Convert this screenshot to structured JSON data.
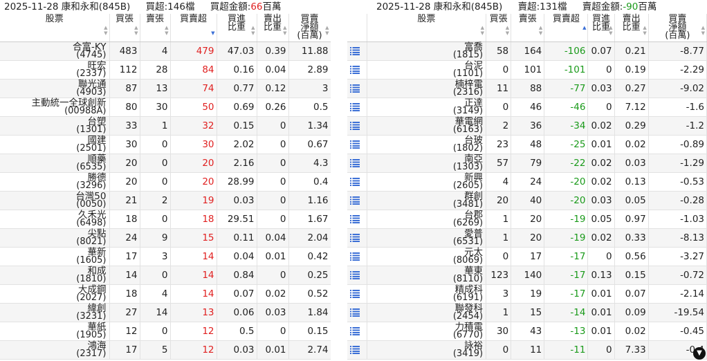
{
  "left": {
    "title": {
      "date": "2025-11-28",
      "broker": "康和永和(845B)",
      "summary": "買超:146檔",
      "amount_label": "買超金額:",
      "amount_value": "66",
      "amount_unit": "百萬"
    },
    "headers": [
      "股票",
      "買張",
      "賣張",
      "買賣超",
      "買進\n比重",
      "賣出\n比重",
      "買賣\n淨額\n(百萬)"
    ],
    "rows": [
      {
        "name": "合富-KY",
        "code": "(4745)",
        "buy": "483",
        "sell": "4",
        "net": "479",
        "buy_pct": "47.03",
        "sell_pct": "0.39",
        "amount": "11.88"
      },
      {
        "name": "旺宏",
        "code": "(2337)",
        "buy": "112",
        "sell": "28",
        "net": "84",
        "buy_pct": "0.16",
        "sell_pct": "0.04",
        "amount": "2.89"
      },
      {
        "name": "聯光通",
        "code": "(4903)",
        "buy": "87",
        "sell": "13",
        "net": "74",
        "buy_pct": "0.77",
        "sell_pct": "0.12",
        "amount": "3"
      },
      {
        "name": "主動統一全球創新",
        "code": "(00988A)",
        "buy": "80",
        "sell": "30",
        "net": "50",
        "buy_pct": "0.69",
        "sell_pct": "0.26",
        "amount": "0.5"
      },
      {
        "name": "台塑",
        "code": "(1301)",
        "buy": "33",
        "sell": "1",
        "net": "32",
        "buy_pct": "0.15",
        "sell_pct": "0",
        "amount": "1.34"
      },
      {
        "name": "國建",
        "code": "(2501)",
        "buy": "30",
        "sell": "0",
        "net": "30",
        "buy_pct": "2.02",
        "sell_pct": "0",
        "amount": "0.67"
      },
      {
        "name": "順藥",
        "code": "(6535)",
        "buy": "20",
        "sell": "0",
        "net": "20",
        "buy_pct": "2.16",
        "sell_pct": "0",
        "amount": "4.3"
      },
      {
        "name": "勝德",
        "code": "(3296)",
        "buy": "20",
        "sell": "0",
        "net": "20",
        "buy_pct": "28.99",
        "sell_pct": "0",
        "amount": "0.4"
      },
      {
        "name": "台灣50",
        "code": "(0050)",
        "buy": "21",
        "sell": "2",
        "net": "19",
        "buy_pct": "0.03",
        "sell_pct": "0",
        "amount": "1.16"
      },
      {
        "name": "久禾光",
        "code": "(6498)",
        "buy": "18",
        "sell": "0",
        "net": "18",
        "buy_pct": "29.51",
        "sell_pct": "0",
        "amount": "1.67"
      },
      {
        "name": "尖點",
        "code": "(8021)",
        "buy": "24",
        "sell": "9",
        "net": "15",
        "buy_pct": "0.11",
        "sell_pct": "0.04",
        "amount": "2.04"
      },
      {
        "name": "華新",
        "code": "(1605)",
        "buy": "17",
        "sell": "3",
        "net": "14",
        "buy_pct": "0.04",
        "sell_pct": "0.01",
        "amount": "0.42"
      },
      {
        "name": "和成",
        "code": "(1810)",
        "buy": "14",
        "sell": "0",
        "net": "14",
        "buy_pct": "0.84",
        "sell_pct": "0",
        "amount": "0.25"
      },
      {
        "name": "大成鋼",
        "code": "(2027)",
        "buy": "18",
        "sell": "4",
        "net": "14",
        "buy_pct": "0.07",
        "sell_pct": "0.02",
        "amount": "0.52"
      },
      {
        "name": "緯創",
        "code": "(3231)",
        "buy": "27",
        "sell": "14",
        "net": "13",
        "buy_pct": "0.06",
        "sell_pct": "0.03",
        "amount": "1.84"
      },
      {
        "name": "華紙",
        "code": "(1905)",
        "buy": "12",
        "sell": "0",
        "net": "12",
        "buy_pct": "0.5",
        "sell_pct": "0",
        "amount": "0.15"
      },
      {
        "name": "鴻海",
        "code": "(2317)",
        "buy": "17",
        "sell": "5",
        "net": "12",
        "buy_pct": "0.03",
        "sell_pct": "0.01",
        "amount": "2.74"
      }
    ]
  },
  "right": {
    "title": {
      "date": "2025-11-28",
      "broker": "康和永和(845B)",
      "summary": "賣超:131檔",
      "amount_label": "賣超金額:",
      "amount_value": "-90",
      "amount_unit": "百萬"
    },
    "headers": [
      "",
      "股票",
      "買張",
      "賣張",
      "買賣超",
      "買進\n比重",
      "賣出\n比重",
      "買賣\n淨額\n(百萬)"
    ],
    "icon": "list-icon",
    "rows": [
      {
        "name": "富喬",
        "code": "(1815)",
        "buy": "58",
        "sell": "164",
        "net": "-106",
        "buy_pct": "0.07",
        "sell_pct": "0.21",
        "amount": "-8.77"
      },
      {
        "name": "台泥",
        "code": "(1101)",
        "buy": "0",
        "sell": "101",
        "net": "-101",
        "buy_pct": "0",
        "sell_pct": "0.19",
        "amount": "-2.29"
      },
      {
        "name": "楠梓電",
        "code": "(2316)",
        "buy": "11",
        "sell": "88",
        "net": "-77",
        "buy_pct": "0.03",
        "sell_pct": "0.27",
        "amount": "-9.02"
      },
      {
        "name": "正達",
        "code": "(3149)",
        "buy": "0",
        "sell": "46",
        "net": "-46",
        "buy_pct": "0",
        "sell_pct": "7.12",
        "amount": "-1.6"
      },
      {
        "name": "華電網",
        "code": "(6163)",
        "buy": "2",
        "sell": "36",
        "net": "-34",
        "buy_pct": "0.02",
        "sell_pct": "0.29",
        "amount": "-1.2"
      },
      {
        "name": "台玻",
        "code": "(1802)",
        "buy": "23",
        "sell": "48",
        "net": "-25",
        "buy_pct": "0.01",
        "sell_pct": "0.02",
        "amount": "-0.89"
      },
      {
        "name": "南亞",
        "code": "(1303)",
        "buy": "57",
        "sell": "79",
        "net": "-22",
        "buy_pct": "0.02",
        "sell_pct": "0.03",
        "amount": "-1.29"
      },
      {
        "name": "新興",
        "code": "(2605)",
        "buy": "4",
        "sell": "24",
        "net": "-20",
        "buy_pct": "0.02",
        "sell_pct": "0.13",
        "amount": "-0.53"
      },
      {
        "name": "群創",
        "code": "(3481)",
        "buy": "20",
        "sell": "40",
        "net": "-20",
        "buy_pct": "0.03",
        "sell_pct": "0.05",
        "amount": "-0.28"
      },
      {
        "name": "台郡",
        "code": "(6269)",
        "buy": "1",
        "sell": "20",
        "net": "-19",
        "buy_pct": "0.05",
        "sell_pct": "0.97",
        "amount": "-1.03"
      },
      {
        "name": "愛普",
        "code": "(6531)",
        "buy": "1",
        "sell": "20",
        "net": "-19",
        "buy_pct": "0.02",
        "sell_pct": "0.33",
        "amount": "-8.13"
      },
      {
        "name": "元太",
        "code": "(8069)",
        "buy": "0",
        "sell": "17",
        "net": "-17",
        "buy_pct": "0",
        "sell_pct": "0.56",
        "amount": "-3.27"
      },
      {
        "name": "華東",
        "code": "(8110)",
        "buy": "123",
        "sell": "140",
        "net": "-17",
        "buy_pct": "0.13",
        "sell_pct": "0.15",
        "amount": "-0.72"
      },
      {
        "name": "精成科",
        "code": "(6191)",
        "buy": "3",
        "sell": "19",
        "net": "-17",
        "buy_pct": "0.01",
        "sell_pct": "0.07",
        "amount": "-2.14"
      },
      {
        "name": "聯發科",
        "code": "(2454)",
        "buy": "1",
        "sell": "15",
        "net": "-14",
        "buy_pct": "0.01",
        "sell_pct": "0.09",
        "amount": "-19.54"
      },
      {
        "name": "力積電",
        "code": "(6770)",
        "buy": "30",
        "sell": "43",
        "net": "-13",
        "buy_pct": "0.01",
        "sell_pct": "0.02",
        "amount": "-0.45"
      },
      {
        "name": "詠裕",
        "code": "(3419)",
        "buy": "0",
        "sell": "11",
        "net": "-11",
        "buy_pct": "0",
        "sell_pct": "7.33",
        "amount": "-0.4"
      }
    ]
  },
  "colors": {
    "positive": "#e02020",
    "negative": "#1a9a1a",
    "icon": "#3b6fd6"
  }
}
